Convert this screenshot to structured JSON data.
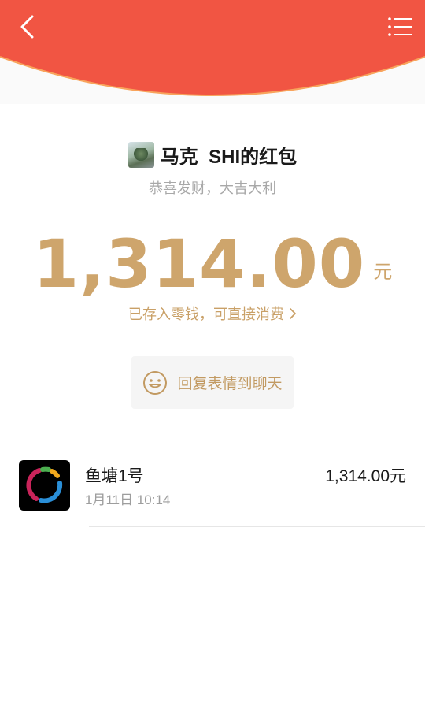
{
  "header": {
    "back_icon": "chevron-left-icon",
    "menu_icon": "list-menu-icon",
    "colors": {
      "red": "#f15543",
      "trim": "#f8a45c"
    }
  },
  "sender": {
    "name": "马克_SHI的红包",
    "wish": "恭喜发财，大吉大利"
  },
  "amount": {
    "value": "1,314.00",
    "unit": "元",
    "color": "#cea56c"
  },
  "deposit_link": {
    "label": "已存入零钱，可直接消费"
  },
  "reply_button": {
    "label": "回复表情到聊天",
    "icon": "smiley-icon"
  },
  "records": [
    {
      "name": "鱼塘1号",
      "time": "1月11日 10:14",
      "amount": "1,314.00元"
    }
  ]
}
